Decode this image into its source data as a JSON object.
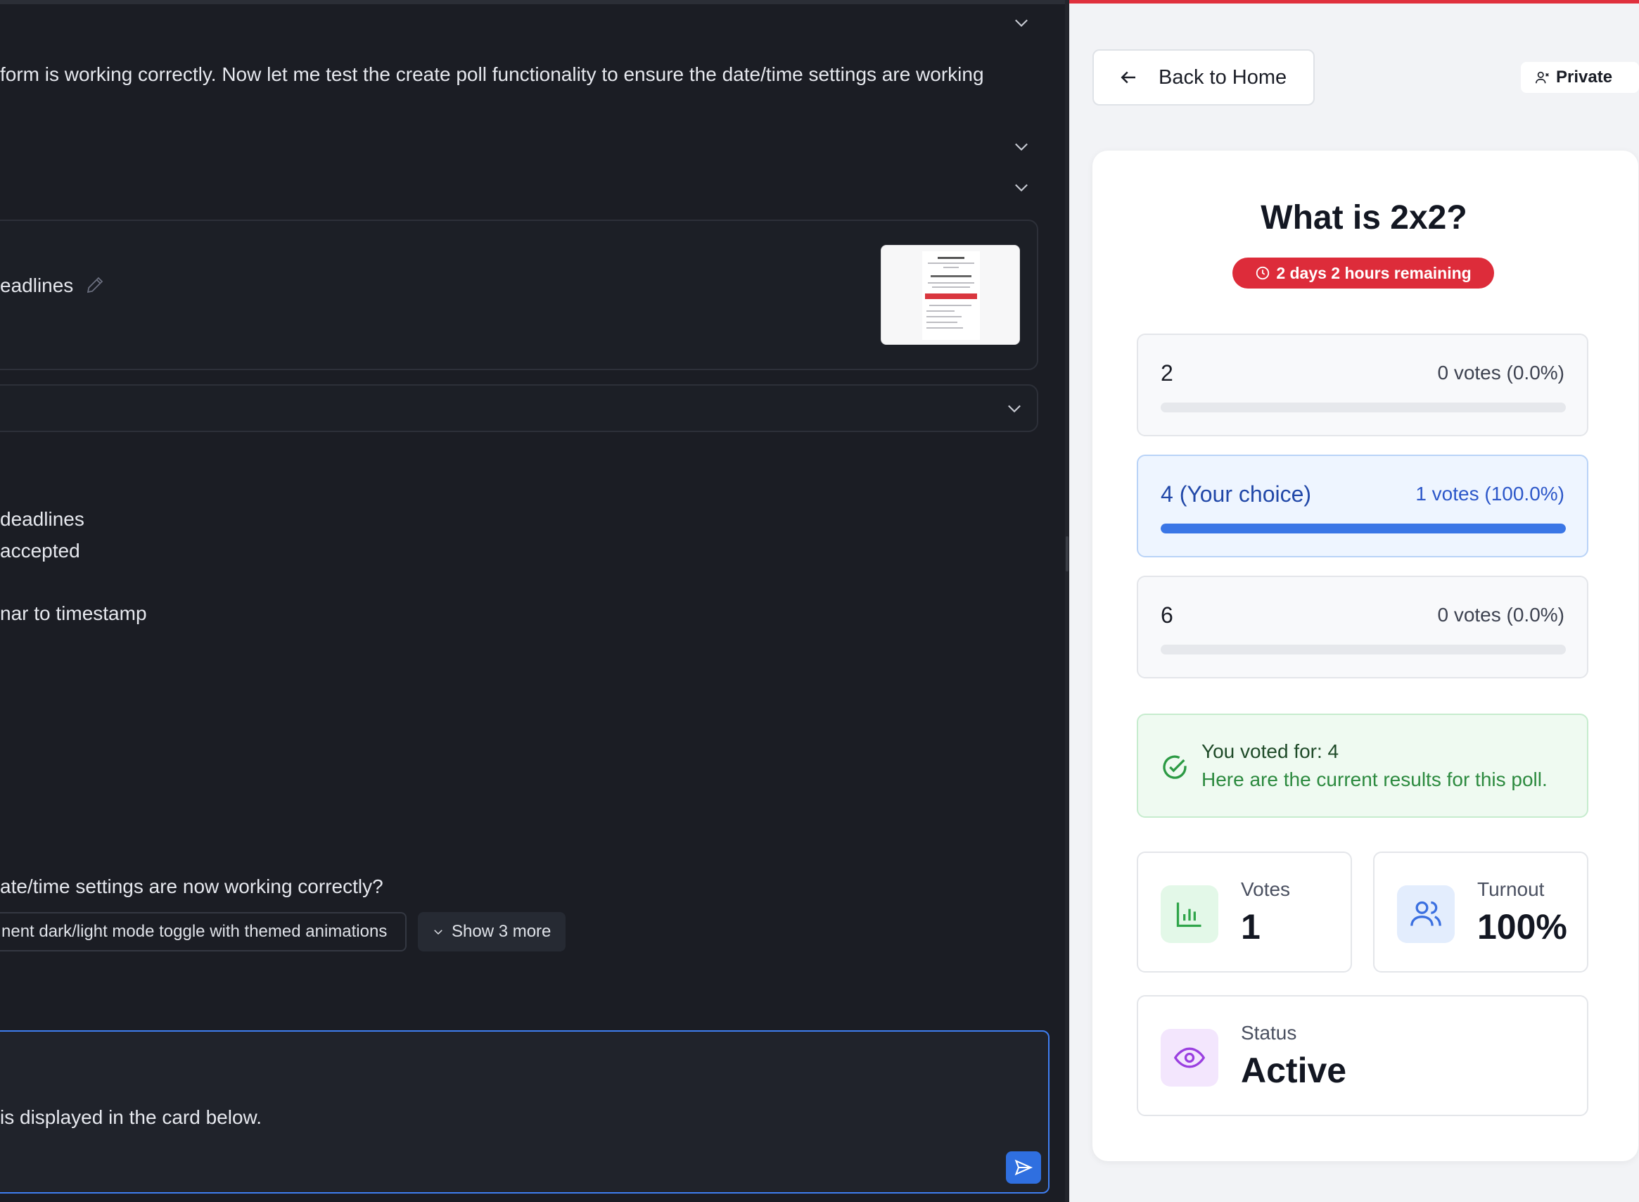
{
  "chat": {
    "message_line": "form is working correctly. Now let me test the create poll functionality to ensure the date/time settings are working",
    "attachment_title": "eadlines",
    "bullet_1": "deadlines",
    "bullet_2": "accepted",
    "bullet_3": "nar to timestamp",
    "question": "ate/time settings are now working correctly?",
    "suggestion_chip": "nent dark/light mode toggle with themed animations",
    "show_more": "Show 3 more",
    "input_text": "is displayed in the card below."
  },
  "app": {
    "back_label": "Back to Home",
    "visibility_label": "Private",
    "poll_title": "What is 2x2?",
    "time_remaining": "2 days 2 hours remaining",
    "options": [
      {
        "label": "2",
        "votes_text": "0 votes (0.0%)",
        "percent": 0
      },
      {
        "label": "4 (Your choice)",
        "votes_text": "1 votes (100.0%)",
        "percent": 100
      },
      {
        "label": "6",
        "votes_text": "0 votes (0.0%)",
        "percent": 0
      }
    ],
    "voted_for": "You voted for: 4",
    "voted_note": "Here are the current results for this poll.",
    "stats": {
      "votes_label": "Votes",
      "votes_value": "1",
      "turnout_label": "Turnout",
      "turnout_value": "100%",
      "status_label": "Status",
      "status_value": "Active"
    }
  },
  "colors": {
    "accent_red": "#dd2c3a",
    "bar_blue": "#3a76e6",
    "success_green": "#2c8a3f"
  }
}
